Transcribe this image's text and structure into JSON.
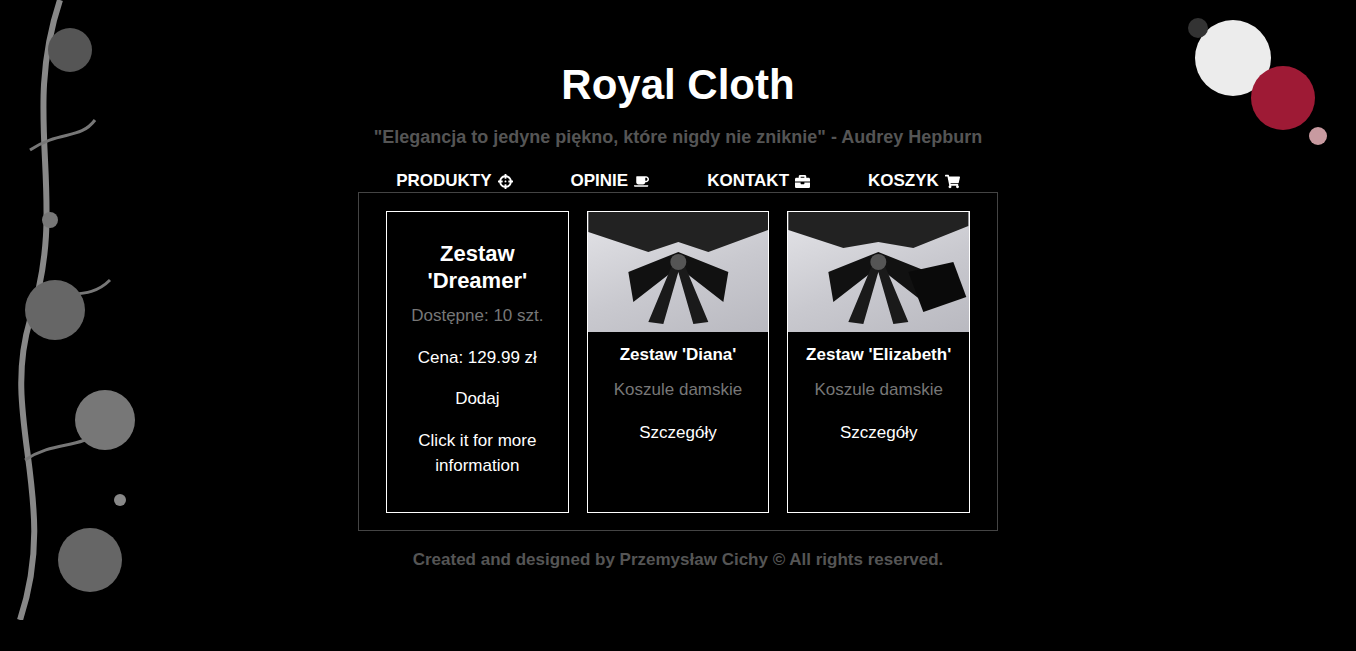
{
  "header": {
    "title": "Royal Cloth",
    "quote": "\"Elegancja to jedyne piękno, które nigdy nie zniknie\" - Audrey Hepburn"
  },
  "nav": [
    {
      "label": "PRODUKTY"
    },
    {
      "label": "OPINIE"
    },
    {
      "label": "KONTAKT"
    },
    {
      "label": "KOSZYK"
    }
  ],
  "products": [
    {
      "kind": "details",
      "title": "Zestaw 'Dreamer'",
      "availability": "Dostępne: 10 szt.",
      "price": "Cena: 129.99 zł",
      "action": "Dodaj",
      "hint": "Click it for more information"
    },
    {
      "kind": "preview",
      "title": "Zestaw 'Diana'",
      "category": "Koszule damskie",
      "action": "Szczegóły"
    },
    {
      "kind": "preview",
      "title": "Zestaw 'Elizabeth'",
      "category": "Koszule damskie",
      "action": "Szczegóły"
    }
  ],
  "footer": "Created and designed by Przemysław Cichy © All rights reserved."
}
